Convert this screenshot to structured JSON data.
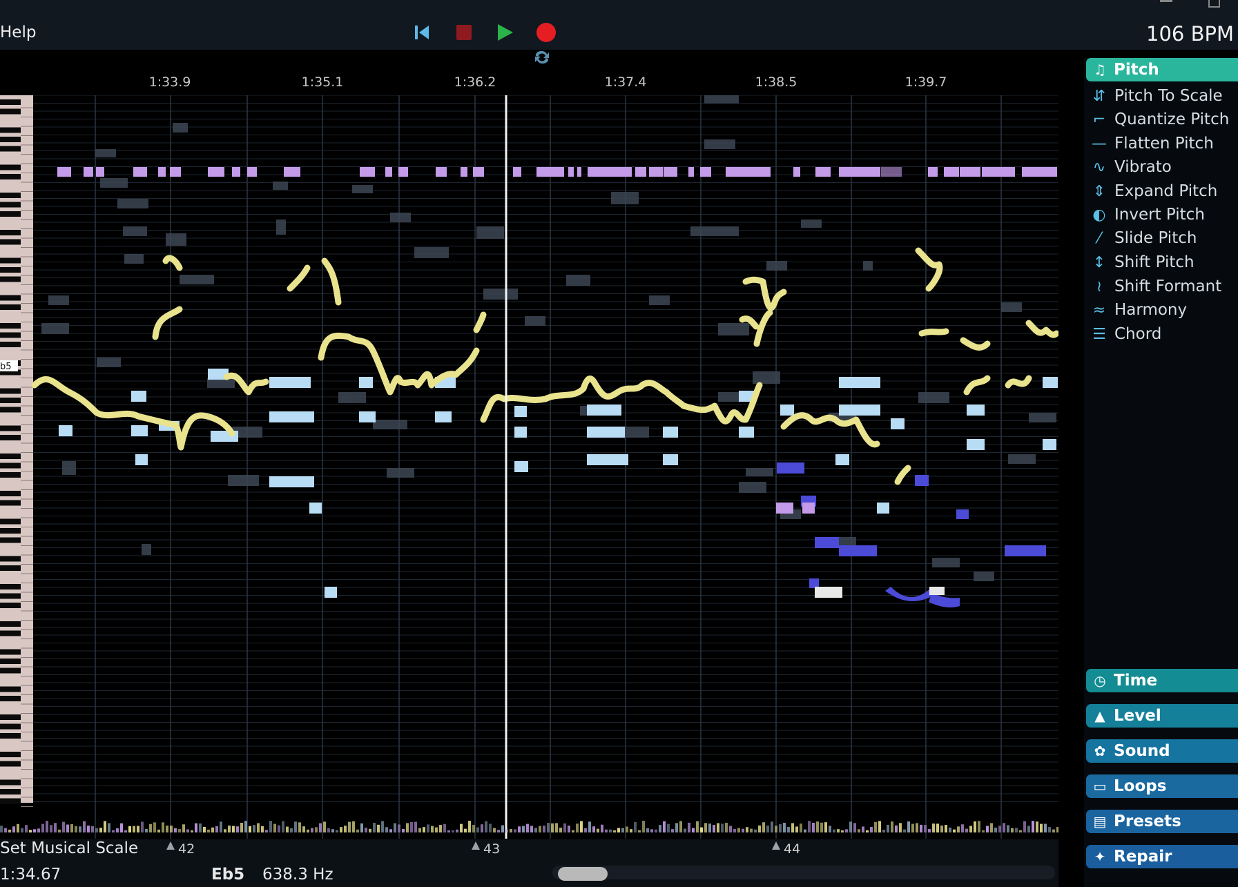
{
  "menu": {
    "help": "Help"
  },
  "transport": {
    "tempo": "106 BPM"
  },
  "ruler": {
    "times": [
      "1:33.9",
      "1:35.1",
      "1:36.2",
      "1:37.4",
      "1:38.5",
      "1:39.7"
    ]
  },
  "keyboard": {
    "marker": "b5"
  },
  "bars": [
    "42",
    "43",
    "44"
  ],
  "status": {
    "action": "Set Musical Scale",
    "time": "1:34.67",
    "note": "Eb5",
    "freq": "638.3 Hz"
  },
  "panel": {
    "pitch_header": "Pitch",
    "tools": [
      {
        "label": "Pitch To Scale",
        "icon": "pitch-to-scale-icon"
      },
      {
        "label": "Quantize Pitch",
        "icon": "quantize-icon"
      },
      {
        "label": "Flatten Pitch",
        "icon": "flatten-icon"
      },
      {
        "label": "Vibrato",
        "icon": "vibrato-icon"
      },
      {
        "label": "Expand Pitch",
        "icon": "expand-icon"
      },
      {
        "label": "Invert Pitch",
        "icon": "invert-icon"
      },
      {
        "label": "Slide Pitch",
        "icon": "slide-icon"
      },
      {
        "label": "Shift Pitch",
        "icon": "shift-icon"
      },
      {
        "label": "Shift Formant",
        "icon": "formant-icon"
      },
      {
        "label": "Harmony",
        "icon": "harmony-icon"
      },
      {
        "label": "Chord",
        "icon": "chord-icon"
      }
    ],
    "sections": [
      {
        "label": "Time",
        "icon": "clock-icon"
      },
      {
        "label": "Level",
        "icon": "mountain-icon"
      },
      {
        "label": "Sound",
        "icon": "palette-icon"
      },
      {
        "label": "Loops",
        "icon": "cassette-icon"
      },
      {
        "label": "Presets",
        "icon": "folder-icon"
      },
      {
        "label": "Repair",
        "icon": "wand-icon"
      }
    ]
  },
  "colors": {
    "lead": "#e9e38e",
    "chord": "#b9dcf5",
    "bass": "#4b4bd8",
    "drum": "#c39be8",
    "ghost": "#3c4654",
    "pitch_accent": "#2ab69d",
    "section_teal": "#148c93",
    "section_blue": "#1a6aa0"
  }
}
